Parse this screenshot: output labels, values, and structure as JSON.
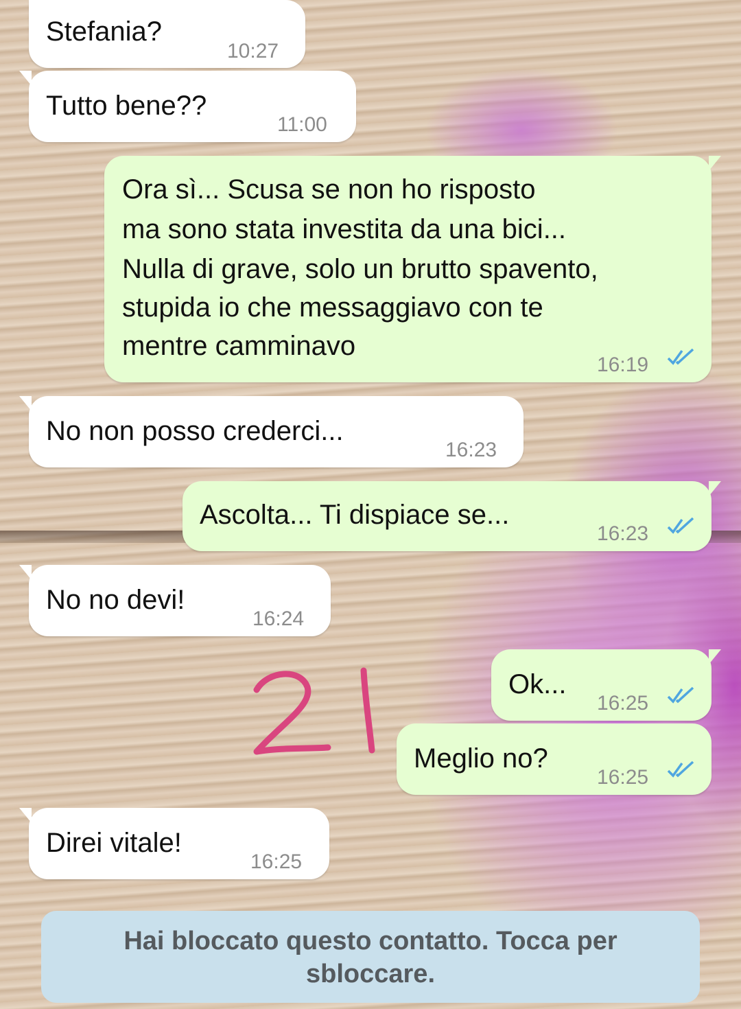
{
  "messages": [
    {
      "direction": "incoming",
      "text": "Stefania?",
      "time": "10:27"
    },
    {
      "direction": "incoming",
      "text": "Tutto bene??",
      "time": "11:00"
    },
    {
      "direction": "outgoing",
      "lines": [
        "Ora sì... Scusa se non ho risposto",
        "ma sono stata investita da una bici...",
        "Nulla di grave, solo un brutto spavento,",
        "stupida io che messaggiavo con te",
        "mentre camminavo"
      ],
      "time": "16:19",
      "status": "read"
    },
    {
      "direction": "incoming",
      "text": "No non posso crederci...",
      "time": "16:23"
    },
    {
      "direction": "outgoing",
      "text": "Ascolta... Ti dispiace se...",
      "time": "16:23",
      "status": "read"
    },
    {
      "direction": "incoming",
      "text": "No no devi!",
      "time": "16:24"
    },
    {
      "direction": "outgoing",
      "text": "Ok...",
      "time": "16:25",
      "status": "read"
    },
    {
      "direction": "outgoing",
      "text": "Meglio no?",
      "time": "16:25",
      "status": "read"
    },
    {
      "direction": "incoming",
      "text": "Direi vitale!",
      "time": "16:25"
    }
  ],
  "handwritten_annotation": "21",
  "blocked_banner": {
    "lines": [
      "Hai bloccato questo contatto. Tocca per",
      "sbloccare."
    ]
  },
  "colors": {
    "incoming_bubble": "#ffffff",
    "outgoing_bubble": "#e6fed2",
    "read_ticks": "#4fa6e0",
    "banner_bg": "#c9e0ec",
    "annotation": "#d9457f"
  },
  "icons": {
    "read_receipt": "double-check-icon"
  }
}
